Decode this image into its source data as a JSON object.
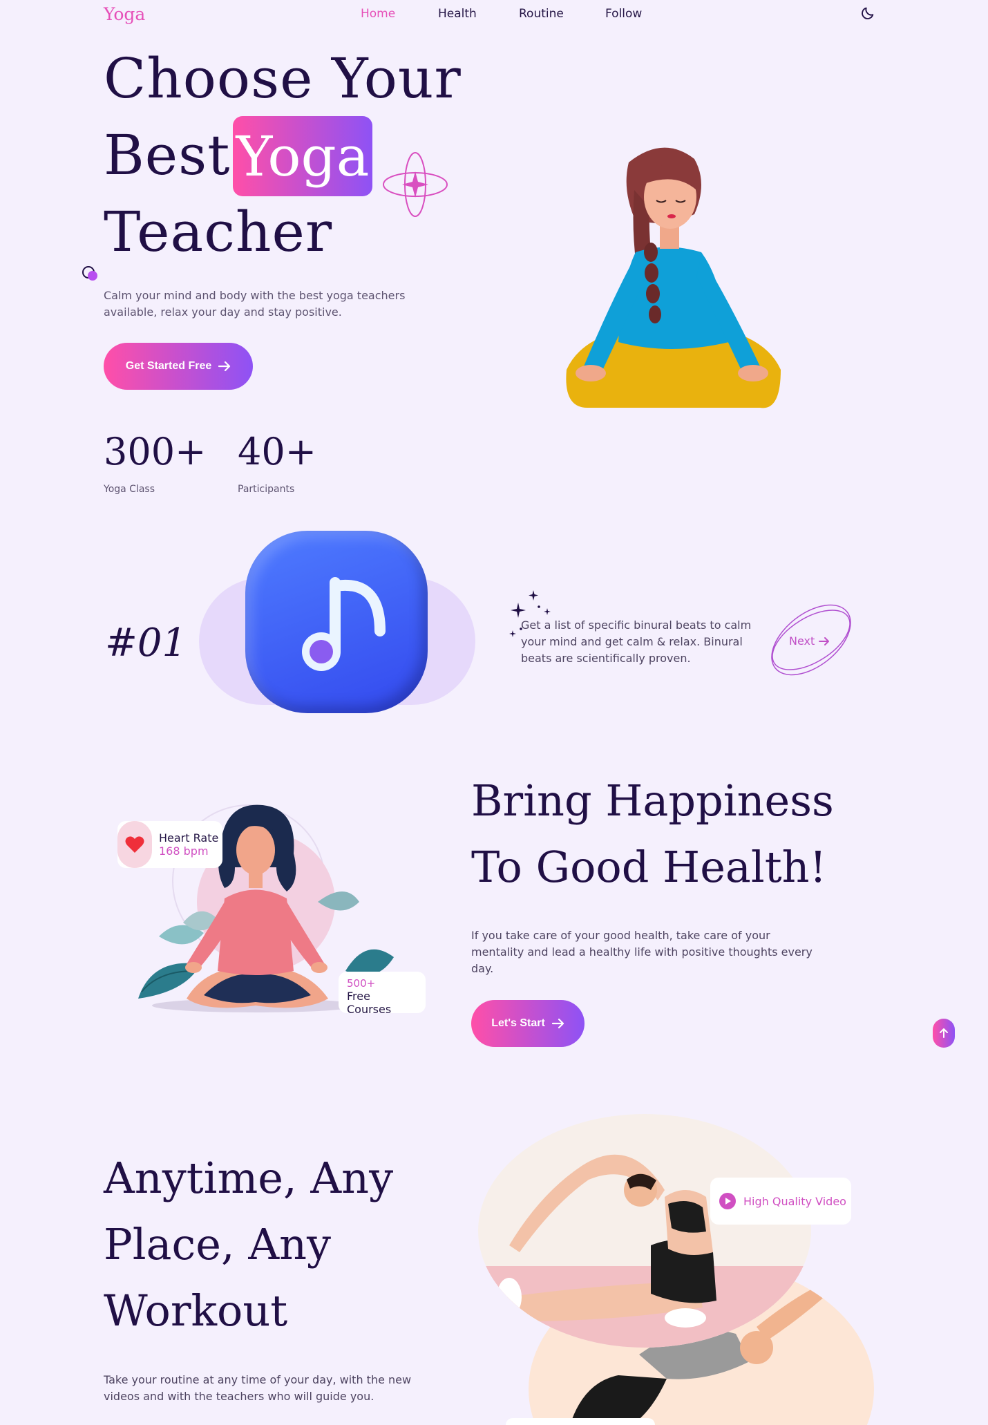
{
  "nav": {
    "logo": "Yoga",
    "items": [
      {
        "label": "Home",
        "active": true
      },
      {
        "label": "Health",
        "active": false
      },
      {
        "label": "Routine",
        "active": false
      },
      {
        "label": "Follow",
        "active": false
      }
    ],
    "theme_toggle_icon": "moon-icon"
  },
  "hero": {
    "line1": "Choose Your",
    "line2": "Best",
    "badge": "Yoga",
    "line3": "Teacher",
    "description": "Calm your mind and body with the best yoga teachers available, relax your day and stay positive.",
    "cta": "Get Started Free",
    "stats": [
      {
        "value": "300+",
        "label": "Yoga Class"
      },
      {
        "value": "40+",
        "label": "Participants"
      }
    ]
  },
  "feature": {
    "number": "#01",
    "icon": "music-note-icon",
    "description": "Get a list of specific binural beats to calm your mind and get calm & relax. Binural beats are scientifically proven.",
    "next": "Next"
  },
  "health": {
    "line1": "Bring Happiness",
    "line2": "To Good Health!",
    "description": "If you take care of your good health, take care of your mentality and lead a healthy life with positive thoughts every day.",
    "cta": "Let's Start",
    "heart_card": {
      "title": "Heart Rate",
      "value": "168 bpm"
    },
    "courses_card": {
      "value": "500+",
      "label": "Free Courses"
    }
  },
  "workout": {
    "line1": "Anytime, Any",
    "line2": "Place, Any",
    "line3": "Workout",
    "description": "Take your routine at any time of your day, with the new videos and with the teachers who will guide you.",
    "video_badge": "High Quality Video"
  },
  "colors": {
    "background": "#f5f0fd",
    "heading": "#200f45",
    "accent_pink": "#ff4fa8",
    "accent_purple": "#8e52f5"
  }
}
